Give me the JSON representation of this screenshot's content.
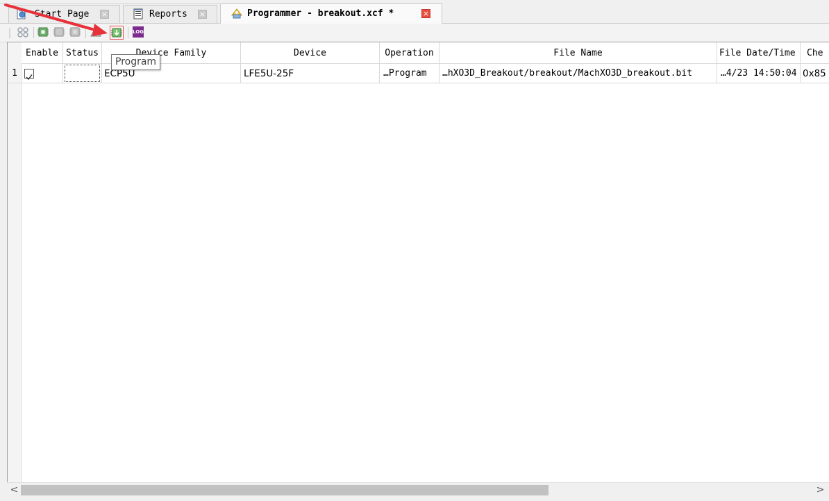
{
  "tabs": [
    {
      "label": "Start Page",
      "icon": "start-page-icon",
      "active": false,
      "close_color": "#c9c9c9"
    },
    {
      "label": "Reports",
      "icon": "reports-icon",
      "active": false,
      "close_color": "#c9c9c9"
    },
    {
      "label": "Programmer - breakout.xcf *",
      "icon": "programmer-icon",
      "active": true,
      "close_color": "#e84c3d"
    }
  ],
  "close_glyph": "×",
  "toolbar": {
    "buttons": [
      "scan-icon",
      "detect-icon",
      "edit-icon",
      "settings-icon",
      "erase-icon",
      "program-icon",
      "log-icon"
    ],
    "highlighted": "program-icon",
    "log_text": "LOG",
    "tooltip": "Program"
  },
  "grid": {
    "columns": [
      "Enable",
      "Status",
      "Device Family",
      "Device",
      "Operation",
      "File Name",
      "File Date/Time",
      "Che"
    ],
    "rows": [
      {
        "row_number": "1",
        "enable": true,
        "status": "",
        "device_family": "ECP5U",
        "device": "LFE5U-25F",
        "operation": "…Program",
        "file_name": "…hXO3D_Breakout/breakout/MachXO3D_breakout.bit",
        "file_datetime": "…4/23 14:50:04",
        "checksum": "0x85"
      }
    ]
  },
  "scrollbar": {
    "left_arrow": "<",
    "right_arrow": ">",
    "position": 0.0,
    "visible_fraction": 0.65
  },
  "colors": {
    "annotation_arrow": "#e8303a",
    "highlight_border": "#e6505a"
  }
}
